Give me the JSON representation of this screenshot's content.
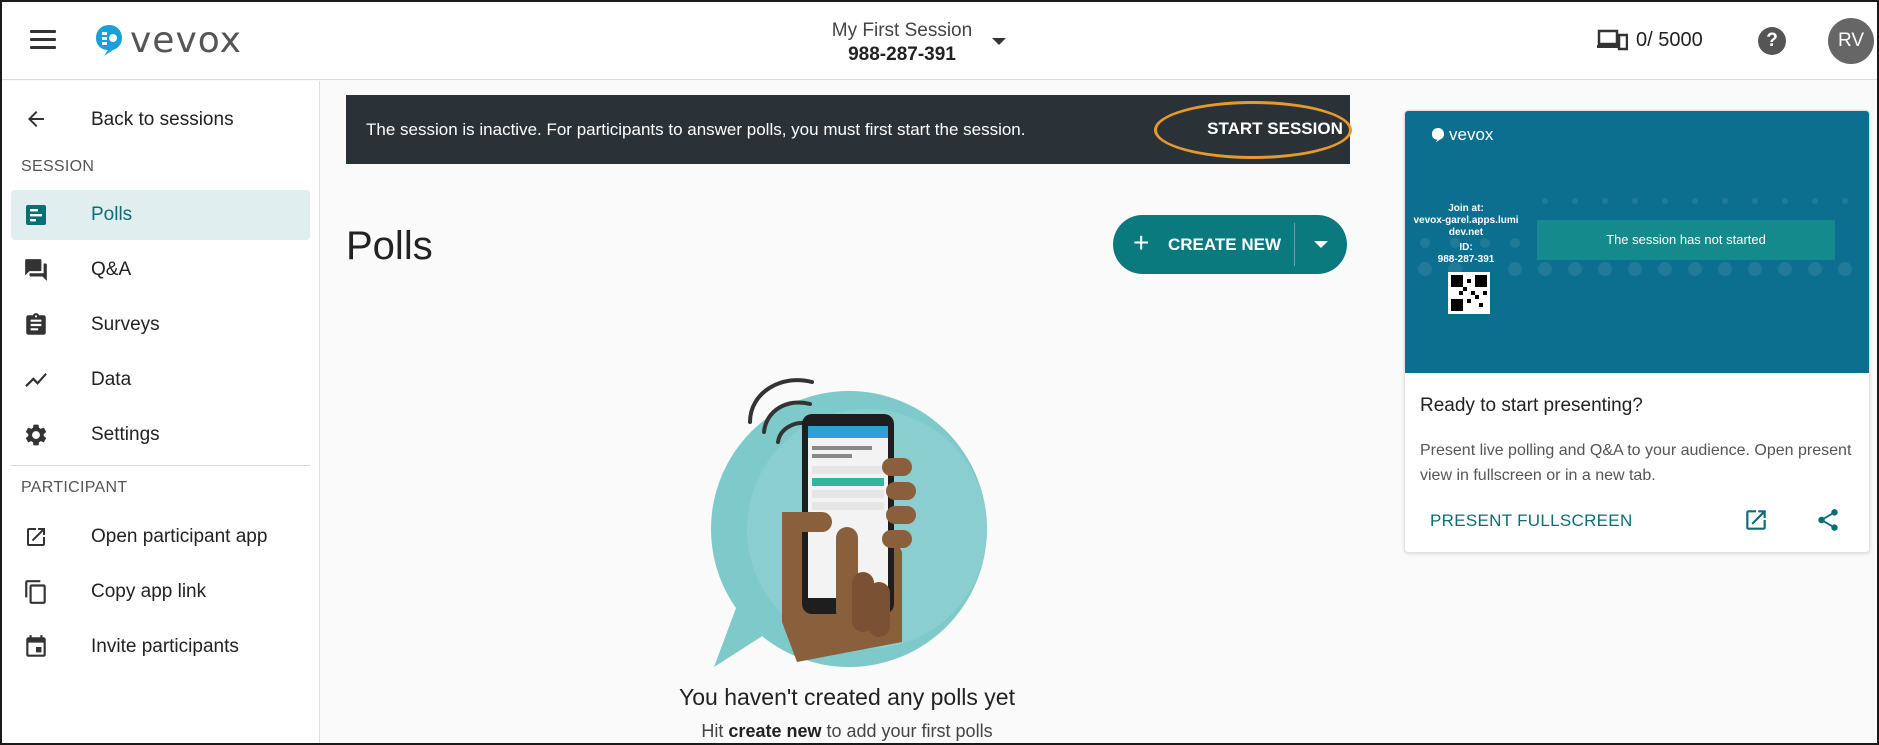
{
  "topbar": {
    "logo_text": "vevox",
    "session_name": "My First Session",
    "session_code": "988-287-391",
    "participants": "0/ 5000",
    "help_glyph": "?",
    "avatar_initials": "RV"
  },
  "sidebar": {
    "back_label": "Back to sessions",
    "session_heading": "SESSION",
    "session_items": [
      {
        "label": "Polls",
        "icon": "polls-icon"
      },
      {
        "label": "Q&A",
        "icon": "qa-icon"
      },
      {
        "label": "Surveys",
        "icon": "surveys-icon"
      },
      {
        "label": "Data",
        "icon": "data-icon"
      },
      {
        "label": "Settings",
        "icon": "gear-icon"
      }
    ],
    "participant_heading": "PARTICIPANT",
    "participant_items": [
      {
        "label": "Open participant app",
        "icon": "external-link-icon"
      },
      {
        "label": "Copy app link",
        "icon": "copy-icon"
      },
      {
        "label": "Invite participants",
        "icon": "calendar-icon"
      }
    ],
    "active_item": "Polls"
  },
  "banner": {
    "message": "The session is inactive. For participants to answer polls, you must first start the session.",
    "start_label": "START SESSION"
  },
  "main": {
    "title": "Polls",
    "create_label": "CREATE NEW",
    "empty_title": "You haven't created any polls yet",
    "empty_sub_prefix": "Hit ",
    "empty_sub_bold": "create new",
    "empty_sub_suffix": " to add your first polls"
  },
  "present_card": {
    "preview_logo": "vevox",
    "preview_join_label": "Join at:",
    "preview_join_url": "vevox-garel.apps.lumi dev.net",
    "preview_id_label": "ID:",
    "preview_id": "988-287-391",
    "preview_status": "The session has not started",
    "heading": "Ready to start presenting?",
    "description": "Present live polling and Q&A to your audience. Open present view in fullscreen or in a new tab.",
    "present_label": "PRESENT FULLSCREEN"
  },
  "colors": {
    "accent": "#0b7a7f",
    "banner_bg": "#2b3237",
    "highlight_ring": "#e79a2c",
    "preview_bg": "#0d6f8f"
  }
}
